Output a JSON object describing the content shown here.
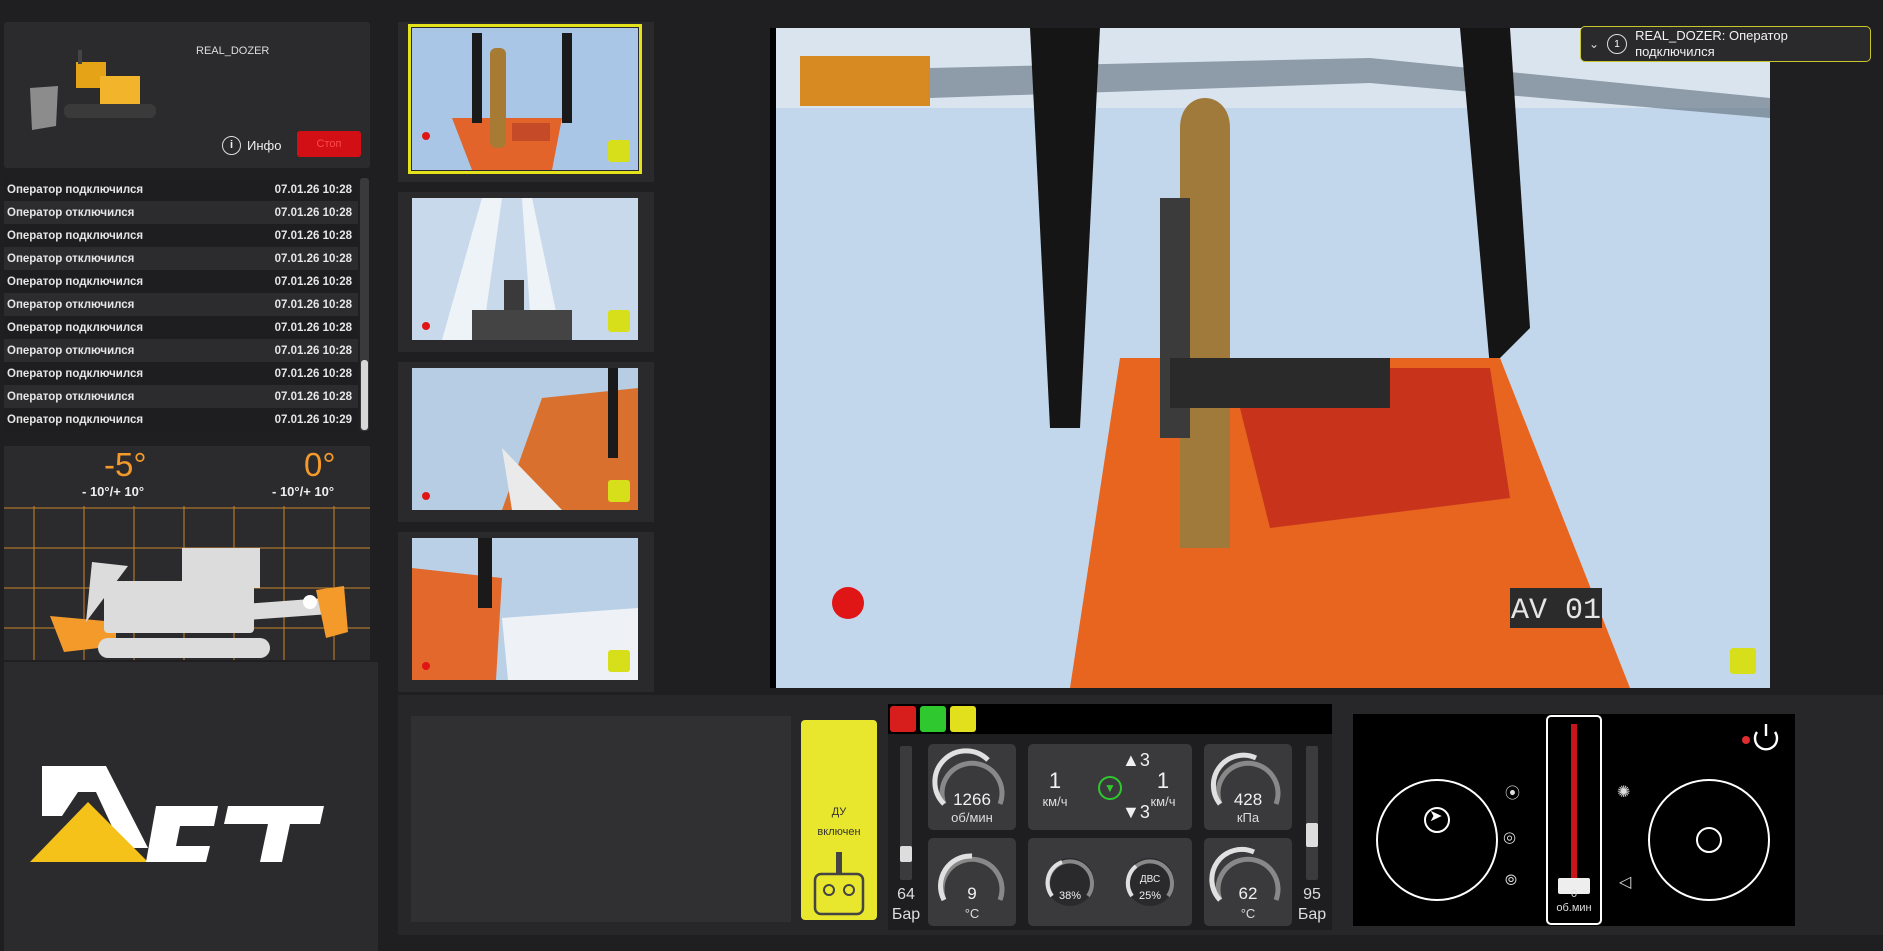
{
  "vehicle": {
    "name": "REAL_DOZER",
    "info_label": "Инфо",
    "stop_label": "Стоп"
  },
  "log": [
    {
      "text": "Оператор подключился",
      "time": "07.01.26 10:28"
    },
    {
      "text": "Оператор отключился",
      "time": "07.01.26 10:28"
    },
    {
      "text": "Оператор подключился",
      "time": "07.01.26 10:28"
    },
    {
      "text": "Оператор отключился",
      "time": "07.01.26 10:28"
    },
    {
      "text": "Оператор подключился",
      "time": "07.01.26 10:28"
    },
    {
      "text": "Оператор отключился",
      "time": "07.01.26 10:28"
    },
    {
      "text": "Оператор подключился",
      "time": "07.01.26 10:28"
    },
    {
      "text": "Оператор отключился",
      "time": "07.01.26 10:28"
    },
    {
      "text": "Оператор подключился",
      "time": "07.01.26 10:28"
    },
    {
      "text": "Оператор отключился",
      "time": "07.01.26 10:28"
    },
    {
      "text": "Оператор подключился",
      "time": "07.01.26 10:29"
    }
  ],
  "tilt": {
    "pitch_value": "-5°",
    "pitch_range": "- 10°/+ 10°",
    "roll_value": "0°",
    "roll_range": "- 10°/+ 10°"
  },
  "logo_text": "ДСТ",
  "cameras": {
    "thumb_label": "AV 01",
    "main_label": "AV 01"
  },
  "notification": {
    "icon": "info-icon",
    "text": "REAL_DOZER: Оператор подключился"
  },
  "remote": {
    "line1": "ДУ",
    "line2": "включен"
  },
  "gauges": {
    "left_pressure": {
      "value": "64",
      "unit": "Бар",
      "level": 0.15
    },
    "right_pressure": {
      "value": "95",
      "unit": "Бар",
      "level": 0.3
    },
    "rpm": {
      "value": "1266",
      "unit": "об/мин"
    },
    "temp_left": {
      "value": "9",
      "unit": "°C"
    },
    "speed_left": {
      "value": "1",
      "unit": "км/ч"
    },
    "speed_right": {
      "value": "1",
      "unit": "км/ч"
    },
    "gear_up": "3",
    "gear_down": "3",
    "fuel_pct": "38%",
    "engine_label": "ДВС",
    "engine_pct": "25%",
    "oil_pressure": {
      "value": "428",
      "unit": "кПа"
    },
    "temp_right": {
      "value": "62",
      "unit": "°C"
    }
  },
  "joystick": {
    "throttle_value": "0",
    "throttle_unit": "об.мин",
    "throttle_level": 0.0
  },
  "colors": {
    "accent_orange": "#f39a2b",
    "accent_yellow": "#e8e72d",
    "stop_red": "#d10f15"
  }
}
